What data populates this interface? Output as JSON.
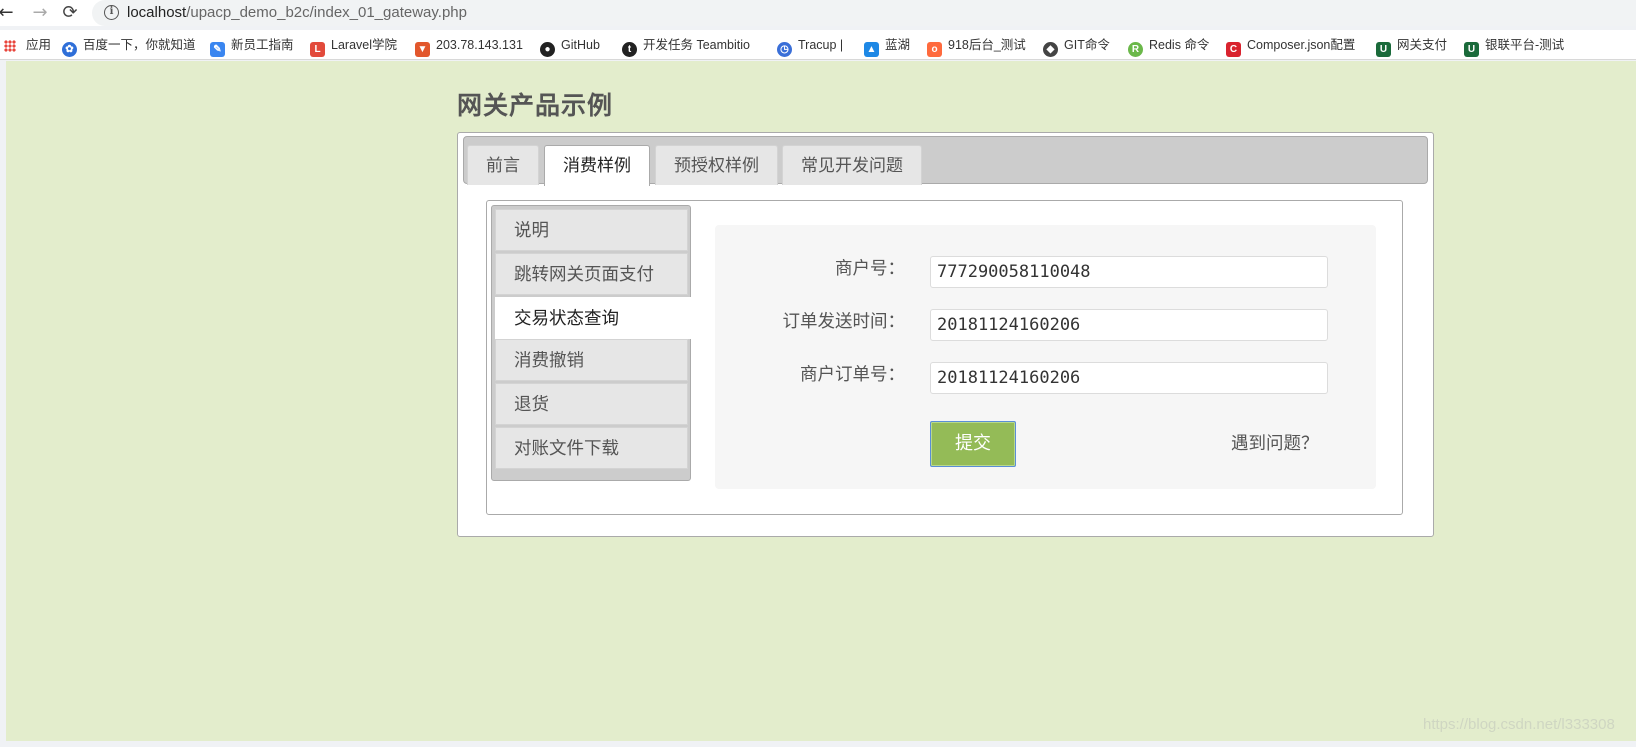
{
  "browser": {
    "url_host": "localhost",
    "url_path": "/upacp_demo_b2c/index_01_gateway.php",
    "bookmarks": [
      {
        "label": "应用",
        "icon": "apps-grid-icon",
        "color": "#e8453c"
      },
      {
        "label": "百度一下，你就知道",
        "icon": "baidu-paw-icon",
        "color": "#2f6fd8"
      },
      {
        "label": "新员工指南",
        "icon": "doc-pen-icon",
        "color": "#3a86f0"
      },
      {
        "label": "Laravel学院",
        "icon": "laravel-icon",
        "color": "#e24a3b"
      },
      {
        "label": "203.78.143.131",
        "icon": "gitlab-fox-icon",
        "color": "#e2572c"
      },
      {
        "label": "GitHub",
        "icon": "github-cat-icon",
        "color": "#222222"
      },
      {
        "label": "开发任务 Teambitio",
        "icon": "teambition-icon",
        "color": "#222222"
      },
      {
        "label": "Tracup |",
        "icon": "tracup-icon",
        "color": "#3a6fd8"
      },
      {
        "label": "蓝湖",
        "icon": "lanhu-icon",
        "color": "#1e88e5"
      },
      {
        "label": "918后台_测试",
        "icon": "olo-icon",
        "color": "#ff6a3d"
      },
      {
        "label": "GIT命令",
        "icon": "git-icon",
        "color": "#444444"
      },
      {
        "label": "Redis 命令",
        "icon": "redis-icon",
        "color": "#6bb84a"
      },
      {
        "label": "Composer.json配置",
        "icon": "composer-c-icon",
        "color": "#d9232e"
      },
      {
        "label": "网关支付",
        "icon": "unionpay-icon",
        "color": "#1a6a3a"
      },
      {
        "label": "银联平台-测试",
        "icon": "unionpay-icon",
        "color": "#1a6a3a"
      }
    ]
  },
  "page": {
    "title": "网关产品示例",
    "background": "#e3edcc",
    "tabs": [
      {
        "label": "前言",
        "active": false
      },
      {
        "label": "消费样例",
        "active": true
      },
      {
        "label": "预授权样例",
        "active": false
      },
      {
        "label": "常见开发问题",
        "active": false
      }
    ],
    "side_menu": [
      {
        "label": "说明",
        "active": false
      },
      {
        "label": "跳转网关页面支付",
        "active": false
      },
      {
        "label": "交易状态查询",
        "active": true
      },
      {
        "label": "消费撤销",
        "active": false
      },
      {
        "label": "退货",
        "active": false
      },
      {
        "label": "对账文件下载",
        "active": false
      }
    ],
    "form": {
      "fields": [
        {
          "label": "商户号：",
          "value": "777290058110048"
        },
        {
          "label": "订单发送时间：",
          "value": "20181124160206"
        },
        {
          "label": "商户订单号：",
          "value": "20181124160206"
        }
      ],
      "submit_label": "提交",
      "submit_color": "#94bb57",
      "help_text": "遇到问题？"
    },
    "watermark": "https://blog.csdn.net/l333308"
  }
}
